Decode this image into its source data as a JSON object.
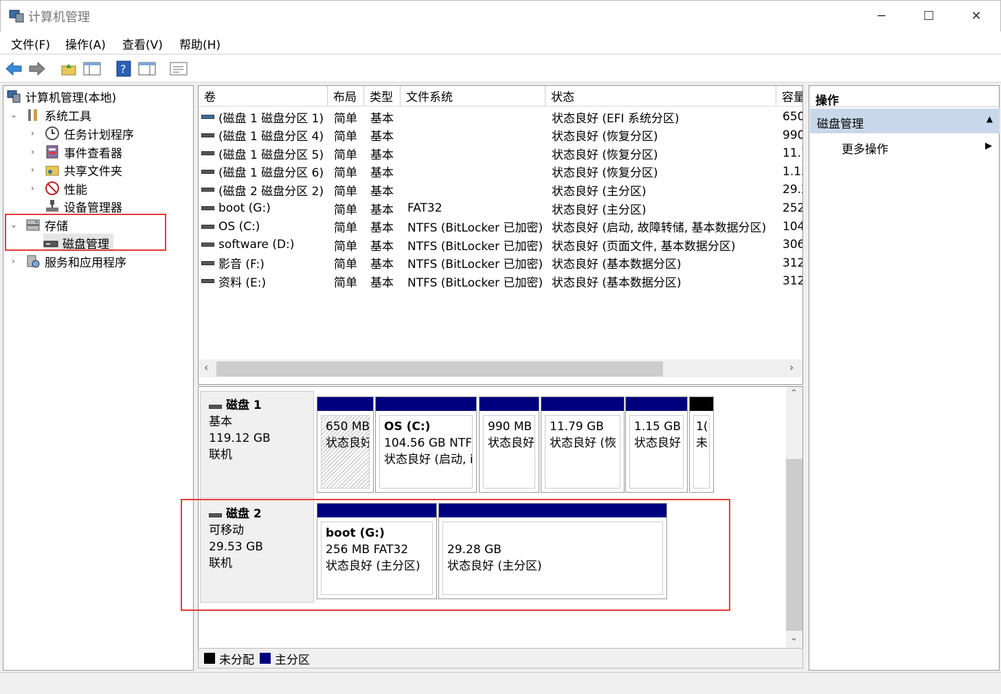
{
  "window": {
    "title": "计算机管理",
    "minimize": "─",
    "maximize": "☐",
    "close": "✕"
  },
  "menu": [
    "文件(F)",
    "操作(A)",
    "查看(V)",
    "帮助(H)"
  ],
  "tree": {
    "root": "计算机管理(本地)",
    "system_tools": "系统工具",
    "task_scheduler": "任务计划程序",
    "event_viewer": "事件查看器",
    "shared_folders": "共享文件夹",
    "performance": "性能",
    "device_manager": "设备管理器",
    "storage": "存储",
    "disk_management": "磁盘管理",
    "services": "服务和应用程序"
  },
  "volume_table": {
    "headers": [
      "卷",
      "布局",
      "类型",
      "文件系统",
      "状态",
      "容量"
    ],
    "rows": [
      {
        "vol": "(磁盘 1 磁盘分区 1)",
        "layout": "简单",
        "type": "基本",
        "fs": "",
        "status": "状态良好 (EFI 系统分区)",
        "cap": "650",
        "sys": true
      },
      {
        "vol": "(磁盘 1 磁盘分区 4)",
        "layout": "简单",
        "type": "基本",
        "fs": "",
        "status": "状态良好 (恢复分区)",
        "cap": "990"
      },
      {
        "vol": "(磁盘 1 磁盘分区 5)",
        "layout": "简单",
        "type": "基本",
        "fs": "",
        "status": "状态良好 (恢复分区)",
        "cap": "11.7"
      },
      {
        "vol": "(磁盘 1 磁盘分区 6)",
        "layout": "简单",
        "type": "基本",
        "fs": "",
        "status": "状态良好 (恢复分区)",
        "cap": "1.15"
      },
      {
        "vol": "(磁盘 2 磁盘分区 2)",
        "layout": "简单",
        "type": "基本",
        "fs": "",
        "status": "状态良好 (主分区)",
        "cap": "29.2"
      },
      {
        "vol": "boot (G:)",
        "layout": "简单",
        "type": "基本",
        "fs": "FAT32",
        "status": "状态良好 (主分区)",
        "cap": "252"
      },
      {
        "vol": "OS (C:)",
        "layout": "简单",
        "type": "基本",
        "fs": "NTFS (BitLocker 已加密)",
        "status": "状态良好 (启动, 故障转储, 基本数据分区)",
        "cap": "104"
      },
      {
        "vol": "software (D:)",
        "layout": "简单",
        "type": "基本",
        "fs": "NTFS (BitLocker 已加密)",
        "status": "状态良好 (页面文件, 基本数据分区)",
        "cap": "306"
      },
      {
        "vol": "影音 (F:)",
        "layout": "简单",
        "type": "基本",
        "fs": "NTFS (BitLocker 已加密)",
        "status": "状态良好 (基本数据分区)",
        "cap": "312"
      },
      {
        "vol": "资料 (E:)",
        "layout": "简单",
        "type": "基本",
        "fs": "NTFS (BitLocker 已加密)",
        "status": "状态良好 (基本数据分区)",
        "cap": "312"
      }
    ]
  },
  "disks": [
    {
      "name": "磁盘 1",
      "kind": "基本",
      "size": "119.12 GB",
      "state": "联机",
      "partitions": [
        {
          "title": "",
          "line1": "650 MB",
          "line2": "状态良好",
          "hatched": true
        },
        {
          "title": "OS  (C:)",
          "line1": "104.56 GB NTFS",
          "line2": "状态良好 (启动, i"
        },
        {
          "title": "",
          "line1": "990 MB",
          "line2": "状态良好"
        },
        {
          "title": "",
          "line1": "11.79 GB",
          "line2": "状态良好 (恢"
        },
        {
          "title": "",
          "line1": "1.15 GB",
          "line2": "状态良好"
        },
        {
          "title": "",
          "line1": "1(",
          "line2": "未",
          "unalloc": true
        }
      ]
    },
    {
      "name": "磁盘 2",
      "kind": "可移动",
      "size": "29.53 GB",
      "state": "联机",
      "partitions": [
        {
          "title": "boot  (G:)",
          "line1": "256 MB FAT32",
          "line2": "状态良好 (主分区)"
        },
        {
          "title": "",
          "line1": "29.28 GB",
          "line2": "状态良好 (主分区)"
        }
      ]
    }
  ],
  "legend": {
    "unallocated": "未分配",
    "primary": "主分区"
  },
  "actions": {
    "title": "操作",
    "section": "磁盘管理",
    "more": "更多操作"
  },
  "colors": {
    "primary": "#00007f",
    "unallocated": "#000000",
    "highlight": "#e53935"
  }
}
